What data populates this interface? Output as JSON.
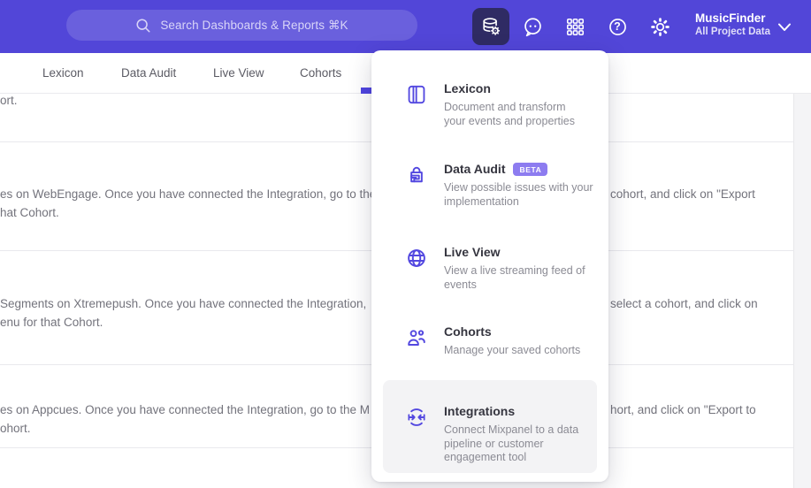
{
  "topbar": {
    "search_placeholder": "Search Dashboards & Reports ⌘K",
    "project_name": "MusicFinder",
    "project_subtitle": "All Project Data",
    "help_glyph": "?"
  },
  "tabs": [
    {
      "label": "Lexicon"
    },
    {
      "label": "Data Audit"
    },
    {
      "label": "Live View"
    },
    {
      "label": "Cohorts"
    }
  ],
  "menu": {
    "items": [
      {
        "title": "Lexicon",
        "desc_lines": [
          "Document and transform",
          "your events and properties"
        ]
      },
      {
        "title": "Data Audit",
        "badge": "BETA",
        "desc_lines": [
          "View possible issues with your",
          "implementation"
        ]
      },
      {
        "title": "Live View",
        "desc_lines": [
          "View a live streaming feed of",
          "events"
        ]
      },
      {
        "title": "Cohorts",
        "desc_lines": [
          "Manage your saved cohorts"
        ]
      },
      {
        "title": "Integrations",
        "desc_lines": [
          "Connect Mixpanel to a data",
          "pipeline or customer",
          "engagement tool"
        ]
      }
    ]
  },
  "background": {
    "rows": [
      {
        "line1_left": "ort."
      },
      {
        "line1_left": "es on WebEngage. Once you have connected the Integration, go to the",
        "line1_right": "cohort, and click on \"Export",
        "line2_left": "hat Cohort."
      },
      {
        "line1_left": "Segments on Xtremepush. Once you have connected the Integration,",
        "line1_right": "select a cohort, and click on",
        "line2_left": "enu for that Cohort."
      },
      {
        "line1_left": "es on Appcues. Once you have connected the Integration, go to the M",
        "line1_right": "hort, and click on \"Export to",
        "line2_left": "ohort."
      }
    ]
  },
  "colors": {
    "topbar_purple": "#5246d8",
    "accent_purple": "#4f44e0",
    "active_button_bg": "#2f2b64",
    "badge_purple": "#8d7cf0",
    "hover_gray": "#f3f3f5"
  }
}
